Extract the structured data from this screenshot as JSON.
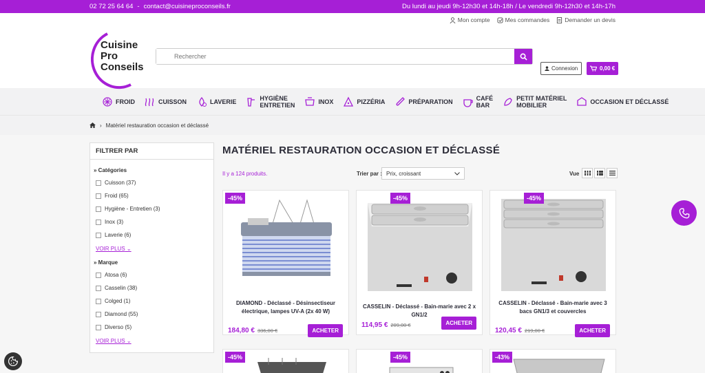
{
  "topbar": {
    "phone": "02 72 25 64 64",
    "separator": "-",
    "email": "contact@cuisineproconseils.fr",
    "hours": "Du lundi au jeudi 9h-12h30 et 14h-18h / Le vendredi 9h-12h30 et 14h-17h"
  },
  "usernav": {
    "account": "Mon compte",
    "orders": "Mes commandes",
    "quote": "Demander un devis"
  },
  "logo": {
    "line1": "Cuisine",
    "line2": "Pro",
    "line3": "Conseils"
  },
  "search": {
    "placeholder": "Rechercher"
  },
  "connexion": "Connexion",
  "cart": "0,00 €",
  "nav": [
    {
      "label1": "FROID",
      "label2": ""
    },
    {
      "label1": "CUISSON",
      "label2": ""
    },
    {
      "label1": "LAVERIE",
      "label2": ""
    },
    {
      "label1": "HYGIÈNE",
      "label2": "ENTRETIEN"
    },
    {
      "label1": "INOX",
      "label2": ""
    },
    {
      "label1": "PIZZÉRIA",
      "label2": ""
    },
    {
      "label1": "PRÉPARATION",
      "label2": ""
    },
    {
      "label1": "CAFÉ",
      "label2": "BAR"
    },
    {
      "label1": "PETIT MATÉRIEL",
      "label2": "MOBILIER"
    },
    {
      "label1": "OCCASION ET DÉCLASSÉ",
      "label2": ""
    }
  ],
  "breadcrumb": "Matériel restauration occasion et déclassé",
  "filter": {
    "head": "FILTRER PAR",
    "cat_title": "Catégories",
    "categories": [
      "Cuisson (37)",
      "Froid (65)",
      "Hygiène - Entretien (3)",
      "Inox (3)",
      "Laverie (6)"
    ],
    "brand_title": "Marque",
    "brands": [
      "Atosa (6)",
      "Casselin (38)",
      "Colged (1)",
      "Diamond (55)",
      "Diverso (5)"
    ],
    "voir_plus": "VOIR PLUS"
  },
  "page_title": "MATÉRIEL RESTAURATION OCCASION ET DÉCLASSÉ",
  "count": "Il y a 124 produits.",
  "sort": {
    "label": "Trier par :",
    "value": "Prix, croissant"
  },
  "vue": "Vue",
  "products": [
    {
      "badge": "-45%",
      "name": "DIAMOND - Déclassé - Désinsectiseur électrique, lampes UV-A (2x 40 W)",
      "price": "184,80 €",
      "old": "336,00 €",
      "buy": "ACHETER"
    },
    {
      "badge": "-45%",
      "name": "CASSELIN - Déclassé - Bain-marie avec 2 x GN1/2",
      "price": "114,95 €",
      "old": "209,00 €",
      "buy": "ACHETER"
    },
    {
      "badge": "-45%",
      "name": "CASSELIN - Déclassé - Bain-marie avec 3 bacs GN1/3 et couvercles",
      "price": "120,45 €",
      "old": "219,00 €",
      "buy": "ACHETER"
    }
  ],
  "products_row2": [
    {
      "badge": "-45%"
    },
    {
      "badge": "-45%"
    },
    {
      "badge": "-43%"
    }
  ],
  "brand_color": "#a61fd6"
}
